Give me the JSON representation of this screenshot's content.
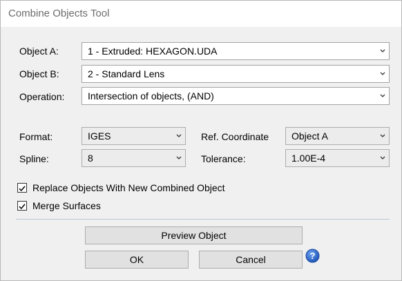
{
  "window": {
    "title": "Combine Objects Tool"
  },
  "object_a": {
    "label": "Object A:",
    "value": "1 - Extruded: HEXAGON.UDA"
  },
  "object_b": {
    "label": "Object B:",
    "value": "2 - Standard Lens"
  },
  "operation": {
    "label": "Operation:",
    "value": "Intersection of objects, (AND)"
  },
  "format": {
    "label": "Format:",
    "value": "IGES"
  },
  "spline": {
    "label": "Spline:",
    "value": "8"
  },
  "ref_coordinate": {
    "label": "Ref. Coordinate",
    "value": "Object A"
  },
  "tolerance": {
    "label": "Tolerance:",
    "value": "1.00E-4"
  },
  "replace_objects": {
    "label": "Replace Objects With New Combined Object",
    "checked": true
  },
  "merge_surfaces": {
    "label": "Merge Surfaces",
    "checked": true
  },
  "buttons": {
    "preview": "Preview Object",
    "ok": "OK",
    "cancel": "Cancel"
  },
  "icons": {
    "dropdown": "chevron-down-icon",
    "check": "checkmark-icon",
    "help": "help-icon"
  },
  "colors": {
    "help_blue": "#2f6ed4",
    "frame_bg": "#f0f0f0"
  }
}
